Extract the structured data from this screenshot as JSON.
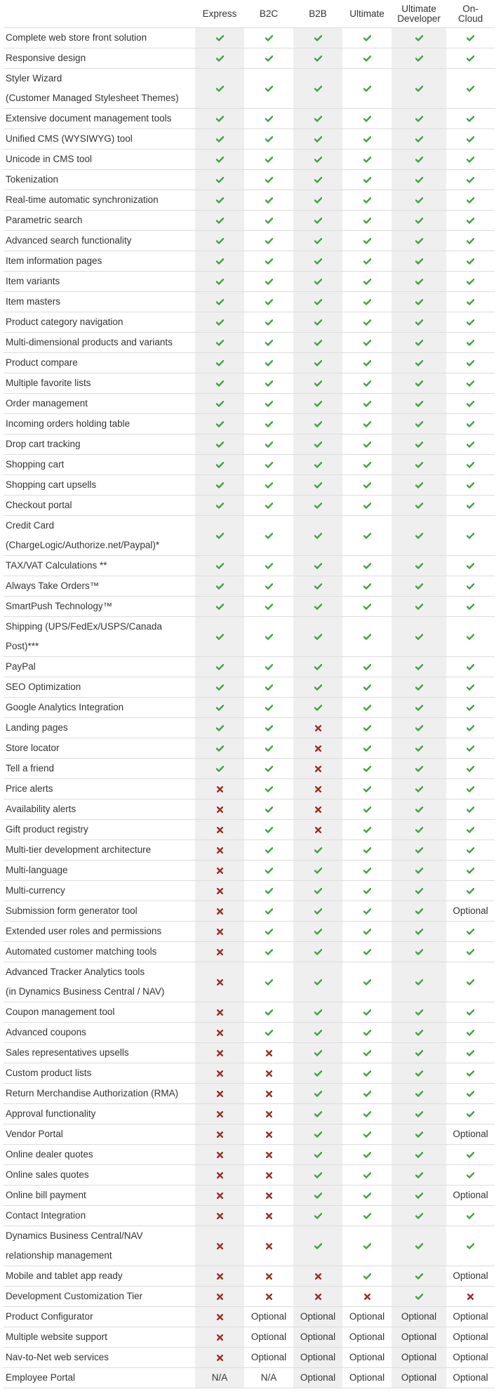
{
  "colors": {
    "check": "#3fa33f",
    "cross": "#9e2a24",
    "shade": "#efefef",
    "border": "#dddddd",
    "text": "#333333"
  },
  "legend": {
    "yes": "check-icon",
    "no": "x-icon"
  },
  "columns": [
    {
      "key": "express",
      "label": "Express"
    },
    {
      "key": "b2c",
      "label": "B2C"
    },
    {
      "key": "b2b",
      "label": "B2B"
    },
    {
      "key": "ultimate",
      "label": "Ultimate"
    },
    {
      "key": "ultimate_developer",
      "label": "Ultimate Developer",
      "lines": [
        "Ultimate",
        "Developer"
      ]
    },
    {
      "key": "on_cloud",
      "label": "On-Cloud",
      "lines": [
        "On-",
        "Cloud"
      ]
    }
  ],
  "rows": [
    {
      "feature": [
        "Complete web store front solution"
      ],
      "values": [
        "yes",
        "yes",
        "yes",
        "yes",
        "yes",
        "yes"
      ]
    },
    {
      "feature": [
        "Responsive design"
      ],
      "values": [
        "yes",
        "yes",
        "yes",
        "yes",
        "yes",
        "yes"
      ]
    },
    {
      "feature": [
        "Styler Wizard",
        "(Customer Managed Stylesheet Themes)"
      ],
      "values": [
        "yes",
        "yes",
        "yes",
        "yes",
        "yes",
        "yes"
      ]
    },
    {
      "feature": [
        "Extensive document management tools"
      ],
      "values": [
        "yes",
        "yes",
        "yes",
        "yes",
        "yes",
        "yes"
      ]
    },
    {
      "feature": [
        "Unified CMS (WYSIWYG) tool"
      ],
      "values": [
        "yes",
        "yes",
        "yes",
        "yes",
        "yes",
        "yes"
      ]
    },
    {
      "feature": [
        "Unicode in CMS tool"
      ],
      "values": [
        "yes",
        "yes",
        "yes",
        "yes",
        "yes",
        "yes"
      ]
    },
    {
      "feature": [
        "Tokenization"
      ],
      "values": [
        "yes",
        "yes",
        "yes",
        "yes",
        "yes",
        "yes"
      ]
    },
    {
      "feature": [
        "Real-time automatic synchronization"
      ],
      "values": [
        "yes",
        "yes",
        "yes",
        "yes",
        "yes",
        "yes"
      ]
    },
    {
      "feature": [
        "Parametric search"
      ],
      "values": [
        "yes",
        "yes",
        "yes",
        "yes",
        "yes",
        "yes"
      ]
    },
    {
      "feature": [
        "Advanced search functionality"
      ],
      "values": [
        "yes",
        "yes",
        "yes",
        "yes",
        "yes",
        "yes"
      ]
    },
    {
      "feature": [
        "Item information pages"
      ],
      "values": [
        "yes",
        "yes",
        "yes",
        "yes",
        "yes",
        "yes"
      ]
    },
    {
      "feature": [
        "Item variants"
      ],
      "values": [
        "yes",
        "yes",
        "yes",
        "yes",
        "yes",
        "yes"
      ]
    },
    {
      "feature": [
        "Item masters"
      ],
      "values": [
        "yes",
        "yes",
        "yes",
        "yes",
        "yes",
        "yes"
      ]
    },
    {
      "feature": [
        "Product category navigation"
      ],
      "values": [
        "yes",
        "yes",
        "yes",
        "yes",
        "yes",
        "yes"
      ]
    },
    {
      "feature": [
        "Multi-dimensional products and variants"
      ],
      "values": [
        "yes",
        "yes",
        "yes",
        "yes",
        "yes",
        "yes"
      ]
    },
    {
      "feature": [
        "Product compare"
      ],
      "values": [
        "yes",
        "yes",
        "yes",
        "yes",
        "yes",
        "yes"
      ]
    },
    {
      "feature": [
        "Multiple favorite lists"
      ],
      "values": [
        "yes",
        "yes",
        "yes",
        "yes",
        "yes",
        "yes"
      ]
    },
    {
      "feature": [
        "Order management"
      ],
      "values": [
        "yes",
        "yes",
        "yes",
        "yes",
        "yes",
        "yes"
      ]
    },
    {
      "feature": [
        "Incoming orders holding table"
      ],
      "values": [
        "yes",
        "yes",
        "yes",
        "yes",
        "yes",
        "yes"
      ]
    },
    {
      "feature": [
        "Drop cart tracking"
      ],
      "values": [
        "yes",
        "yes",
        "yes",
        "yes",
        "yes",
        "yes"
      ]
    },
    {
      "feature": [
        "Shopping cart"
      ],
      "values": [
        "yes",
        "yes",
        "yes",
        "yes",
        "yes",
        "yes"
      ]
    },
    {
      "feature": [
        "Shopping cart upsells"
      ],
      "values": [
        "yes",
        "yes",
        "yes",
        "yes",
        "yes",
        "yes"
      ]
    },
    {
      "feature": [
        "Checkout portal"
      ],
      "values": [
        "yes",
        "yes",
        "yes",
        "yes",
        "yes",
        "yes"
      ]
    },
    {
      "feature": [
        "Credit Card",
        "(ChargeLogic/Authorize.net/Paypal)*"
      ],
      "values": [
        "yes",
        "yes",
        "yes",
        "yes",
        "yes",
        "yes"
      ]
    },
    {
      "feature": [
        "TAX/VAT Calculations **"
      ],
      "values": [
        "yes",
        "yes",
        "yes",
        "yes",
        "yes",
        "yes"
      ]
    },
    {
      "feature": [
        "Always Take Orders™"
      ],
      "values": [
        "yes",
        "yes",
        "yes",
        "yes",
        "yes",
        "yes"
      ]
    },
    {
      "feature": [
        "SmartPush Technology™"
      ],
      "values": [
        "yes",
        "yes",
        "yes",
        "yes",
        "yes",
        "yes"
      ]
    },
    {
      "feature": [
        "Shipping (UPS/FedEx/USPS/Canada",
        "Post)***"
      ],
      "values": [
        "yes",
        "yes",
        "yes",
        "yes",
        "yes",
        "yes"
      ]
    },
    {
      "feature": [
        "PayPal"
      ],
      "values": [
        "yes",
        "yes",
        "yes",
        "yes",
        "yes",
        "yes"
      ]
    },
    {
      "feature": [
        "SEO Optimization"
      ],
      "values": [
        "yes",
        "yes",
        "yes",
        "yes",
        "yes",
        "yes"
      ]
    },
    {
      "feature": [
        "Google Analytics Integration"
      ],
      "values": [
        "yes",
        "yes",
        "yes",
        "yes",
        "yes",
        "yes"
      ]
    },
    {
      "feature": [
        "Landing pages"
      ],
      "values": [
        "yes",
        "yes",
        "no",
        "yes",
        "yes",
        "yes"
      ]
    },
    {
      "feature": [
        "Store locator"
      ],
      "values": [
        "yes",
        "yes",
        "no",
        "yes",
        "yes",
        "yes"
      ]
    },
    {
      "feature": [
        "Tell a friend"
      ],
      "values": [
        "yes",
        "yes",
        "no",
        "yes",
        "yes",
        "yes"
      ]
    },
    {
      "feature": [
        "Price alerts"
      ],
      "values": [
        "no",
        "yes",
        "no",
        "yes",
        "yes",
        "yes"
      ]
    },
    {
      "feature": [
        "Availability alerts"
      ],
      "values": [
        "no",
        "yes",
        "no",
        "yes",
        "yes",
        "yes"
      ]
    },
    {
      "feature": [
        "Gift product registry"
      ],
      "values": [
        "no",
        "yes",
        "no",
        "yes",
        "yes",
        "yes"
      ]
    },
    {
      "feature": [
        "Multi-tier development architecture"
      ],
      "values": [
        "no",
        "yes",
        "yes",
        "yes",
        "yes",
        "yes"
      ]
    },
    {
      "feature": [
        "Multi-language"
      ],
      "values": [
        "no",
        "yes",
        "yes",
        "yes",
        "yes",
        "yes"
      ]
    },
    {
      "feature": [
        "Multi-currency"
      ],
      "values": [
        "no",
        "yes",
        "yes",
        "yes",
        "yes",
        "yes"
      ]
    },
    {
      "feature": [
        "Submission form generator tool"
      ],
      "values": [
        "no",
        "yes",
        "yes",
        "yes",
        "yes",
        "Optional"
      ]
    },
    {
      "feature": [
        "Extended user roles and permissions"
      ],
      "values": [
        "no",
        "yes",
        "yes",
        "yes",
        "yes",
        "yes"
      ]
    },
    {
      "feature": [
        "Automated customer matching tools"
      ],
      "values": [
        "no",
        "yes",
        "yes",
        "yes",
        "yes",
        "yes"
      ]
    },
    {
      "feature": [
        "Advanced Tracker Analytics tools",
        "(in Dynamics Business Central / NAV)"
      ],
      "values": [
        "no",
        "yes",
        "yes",
        "yes",
        "yes",
        "yes"
      ]
    },
    {
      "feature": [
        "Coupon management tool"
      ],
      "values": [
        "no",
        "yes",
        "yes",
        "yes",
        "yes",
        "yes"
      ]
    },
    {
      "feature": [
        "Advanced coupons"
      ],
      "values": [
        "no",
        "yes",
        "yes",
        "yes",
        "yes",
        "yes"
      ]
    },
    {
      "feature": [
        "Sales representatives upsells"
      ],
      "values": [
        "no",
        "no",
        "yes",
        "yes",
        "yes",
        "yes"
      ]
    },
    {
      "feature": [
        "Custom product lists"
      ],
      "values": [
        "no",
        "no",
        "yes",
        "yes",
        "yes",
        "yes"
      ]
    },
    {
      "feature": [
        "Return Merchandise Authorization (RMA)"
      ],
      "values": [
        "no",
        "no",
        "yes",
        "yes",
        "yes",
        "yes"
      ]
    },
    {
      "feature": [
        "Approval functionality"
      ],
      "values": [
        "no",
        "no",
        "yes",
        "yes",
        "yes",
        "yes"
      ]
    },
    {
      "feature": [
        "Vendor Portal"
      ],
      "values": [
        "no",
        "no",
        "yes",
        "yes",
        "yes",
        "Optional"
      ]
    },
    {
      "feature": [
        "Online dealer quotes"
      ],
      "values": [
        "no",
        "no",
        "yes",
        "yes",
        "yes",
        "yes"
      ]
    },
    {
      "feature": [
        "Online sales quotes"
      ],
      "values": [
        "no",
        "no",
        "yes",
        "yes",
        "yes",
        "yes"
      ]
    },
    {
      "feature": [
        "Online bill payment"
      ],
      "values": [
        "no",
        "no",
        "yes",
        "yes",
        "yes",
        "Optional"
      ]
    },
    {
      "feature": [
        "Contact Integration"
      ],
      "values": [
        "no",
        "no",
        "yes",
        "yes",
        "yes",
        "yes"
      ]
    },
    {
      "feature": [
        "Dynamics Business Central/NAV",
        "relationship management"
      ],
      "values": [
        "no",
        "no",
        "yes",
        "yes",
        "yes",
        "yes"
      ]
    },
    {
      "feature": [
        "Mobile and tablet app ready"
      ],
      "values": [
        "no",
        "no",
        "no",
        "yes",
        "yes",
        "Optional"
      ]
    },
    {
      "feature": [
        "Development Customization Tier"
      ],
      "values": [
        "no",
        "no",
        "no",
        "no",
        "yes",
        "no"
      ]
    },
    {
      "feature": [
        "Product Configurator"
      ],
      "values": [
        "no",
        "Optional",
        "Optional",
        "Optional",
        "Optional",
        "Optional"
      ]
    },
    {
      "feature": [
        "Multiple website support"
      ],
      "values": [
        "no",
        "Optional",
        "Optional",
        "Optional",
        "Optional",
        "Optional"
      ]
    },
    {
      "feature": [
        "Nav-to-Net web services"
      ],
      "values": [
        "no",
        "Optional",
        "Optional",
        "Optional",
        "Optional",
        "Optional"
      ]
    },
    {
      "feature": [
        "Employee Portal"
      ],
      "values": [
        "N/A",
        "N/A",
        "Optional",
        "Optional",
        "Optional",
        "Optional"
      ]
    }
  ]
}
